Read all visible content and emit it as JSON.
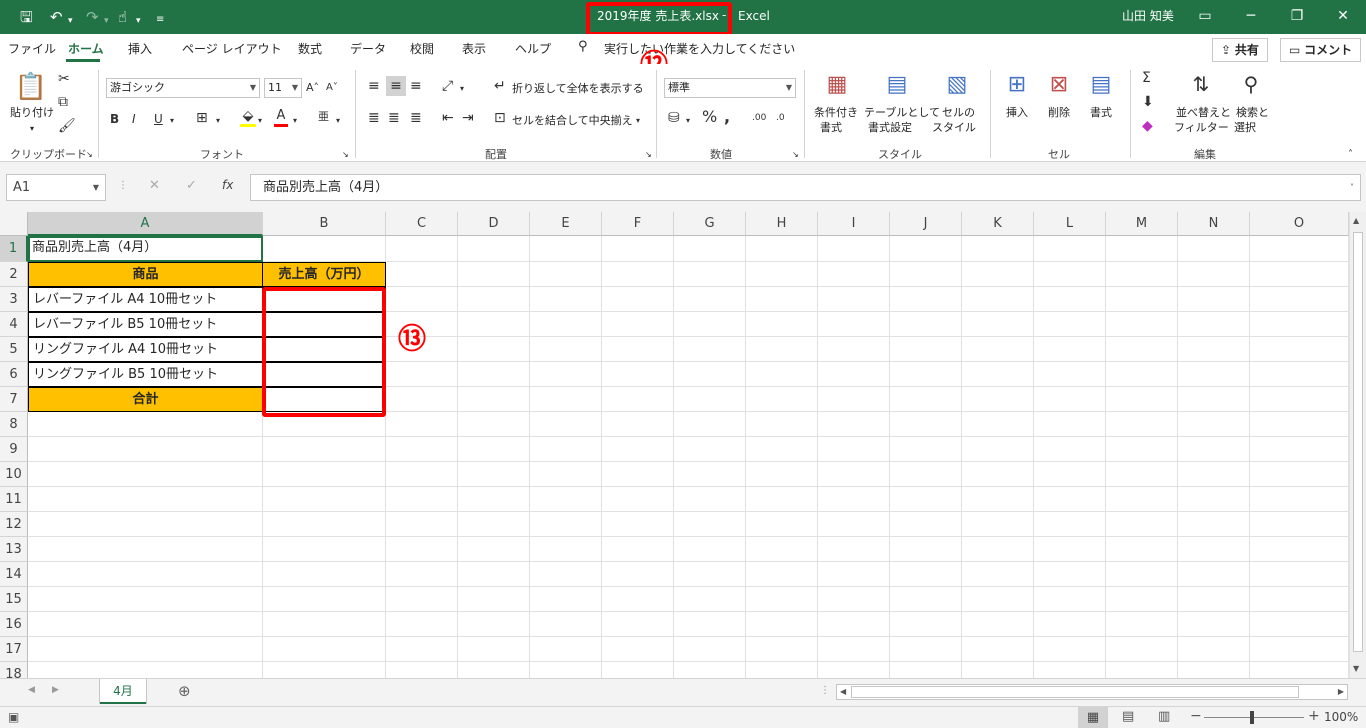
{
  "titlebar": {
    "filename": "2019年度 売上表.xlsx",
    "separator": "-",
    "app_name": "Excel",
    "user_name": "山田 知美",
    "annotation_12": "⑫"
  },
  "menu": {
    "tabs": [
      "ファイル",
      "ホーム",
      "挿入",
      "ページ レイアウト",
      "数式",
      "データ",
      "校閲",
      "表示",
      "ヘルプ"
    ],
    "search_placeholder": "実行したい作業を入力してください",
    "share_label": "共有",
    "comment_label": "コメント"
  },
  "ribbon": {
    "clipboard": {
      "paste_label": "貼り付け",
      "group_label": "クリップボード"
    },
    "font": {
      "font_name": "游ゴシック",
      "font_size": "11",
      "group_label": "フォント"
    },
    "alignment": {
      "wrap_label": "折り返して全体を表示する",
      "merge_label": "セルを結合して中央揃え",
      "group_label": "配置"
    },
    "number": {
      "format": "標準",
      "group_label": "数値"
    },
    "styles": {
      "cond_format": "条件付き",
      "cond_format2": "書式",
      "table_format": "テーブルとして",
      "table_format2": "書式設定",
      "cell_style": "セルの",
      "cell_style2": "スタイル",
      "group_label": "スタイル"
    },
    "cells": {
      "insert": "挿入",
      "delete": "削除",
      "format": "書式",
      "group_label": "セル"
    },
    "editing": {
      "sort": "並べ替えと",
      "sort2": "フィルター",
      "find": "検索と",
      "find2": "選択",
      "group_label": "編集"
    }
  },
  "formula_bar": {
    "name_box": "A1",
    "fx": "fx",
    "content": "商品別売上高（4月）"
  },
  "grid": {
    "columns": [
      "A",
      "B",
      "C",
      "D",
      "E",
      "F",
      "G",
      "H",
      "I",
      "J",
      "K",
      "L",
      "M",
      "N",
      "O"
    ],
    "rows": [
      "1",
      "2",
      "3",
      "4",
      "5",
      "6",
      "7",
      "8",
      "9",
      "10",
      "11",
      "12",
      "13",
      "14",
      "15",
      "16",
      "17",
      "18"
    ],
    "a1": "商品別売上高（4月）",
    "header_product": "商品",
    "header_sales": "売上高（万円）",
    "items": [
      "レバーファイル A4 10冊セット",
      "レバーファイル B5 10冊セット",
      "リングファイル A4 10冊セット",
      "リングファイル B5 10冊セット"
    ],
    "total": "合計",
    "annotation_13": "⑬"
  },
  "sheets": {
    "active": "4月"
  },
  "status": {
    "zoom": "100%"
  },
  "colors": {
    "excel_green": "#217346",
    "header_fill": "#ffc000",
    "annotation_red": "#ff0000"
  }
}
